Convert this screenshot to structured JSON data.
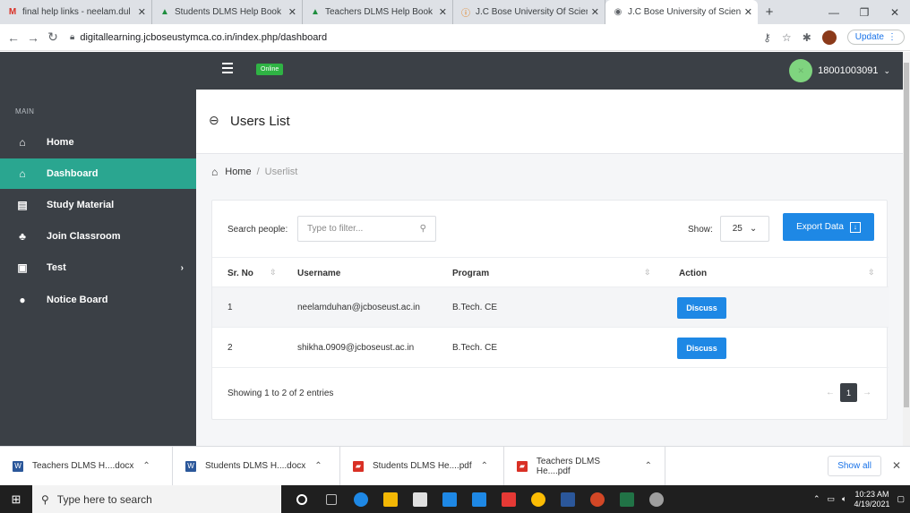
{
  "browser": {
    "tabs": [
      {
        "title": "final help links - neelam.dul",
        "icon_color": "#d93025",
        "icon": "M"
      },
      {
        "title": "Students DLMS Help Book",
        "icon_color": "#1e8e3e",
        "icon": "▲"
      },
      {
        "title": "Teachers DLMS Help Book",
        "icon_color": "#1e8e3e",
        "icon": "▲"
      },
      {
        "title": "J.C Bose University Of Scien",
        "icon_color": "#e37400",
        "icon": "ⓘ"
      },
      {
        "title": "J.C Bose University of Scien",
        "icon_color": "#5f6368",
        "icon": "◉"
      }
    ],
    "url": "digitallearning.jcboseustymca.co.in/index.php/dashboard",
    "update_label": "Update"
  },
  "topbar": {
    "status_badge": "Online",
    "user_id": "18001003091"
  },
  "sidebar": {
    "section": "MAIN",
    "items": [
      {
        "label": "Home",
        "icon": "⌂"
      },
      {
        "label": "Dashboard",
        "icon": "⌂"
      },
      {
        "label": "Study Material",
        "icon": "▤"
      },
      {
        "label": "Join Classroom",
        "icon": "♣"
      },
      {
        "label": "Test",
        "icon": "▣"
      },
      {
        "label": "Notice Board",
        "icon": "●"
      }
    ]
  },
  "page": {
    "title": "Users List",
    "breadcrumb_home": "Home",
    "breadcrumb_current": "Userlist"
  },
  "controls": {
    "search_label": "Search people:",
    "search_placeholder": "Type to filter...",
    "show_label": "Show:",
    "show_value": "25",
    "export_label": "Export Data"
  },
  "table": {
    "headers": [
      "Sr. No",
      "Username",
      "Program",
      "Action"
    ],
    "rows": [
      {
        "sr": "1",
        "username": "neelamduhan@jcboseust.ac.in",
        "program": "B.Tech. CE",
        "action": "Discuss"
      },
      {
        "sr": "2",
        "username": "shikha.0909@jcboseust.ac.in",
        "program": "B.Tech. CE",
        "action": "Discuss"
      }
    ],
    "footer": "Showing 1 to 2 of 2 entries",
    "current_page": "1"
  },
  "downloads": {
    "items": [
      {
        "name": "Teachers DLMS H....docx",
        "color": "#2b579a"
      },
      {
        "name": "Students DLMS H....docx",
        "color": "#2b579a"
      },
      {
        "name": "Students DLMS He....pdf",
        "color": "#d93025"
      },
      {
        "name": "Teachers DLMS He....pdf",
        "color": "#d93025"
      }
    ],
    "show_all": "Show all"
  },
  "taskbar": {
    "search_placeholder": "Type here to search",
    "time": "10:23 AM",
    "date": "4/19/2021",
    "app_colors": [
      "#ffffff",
      "#9e9e9e",
      "#1e88e5",
      "#f2b705",
      "#f2b705",
      "#1e88e5",
      "#1e88e5",
      "#e53935",
      "#fbbc04",
      "#2b579a",
      "#d24726",
      "#217346",
      "#9e9e9e"
    ]
  }
}
